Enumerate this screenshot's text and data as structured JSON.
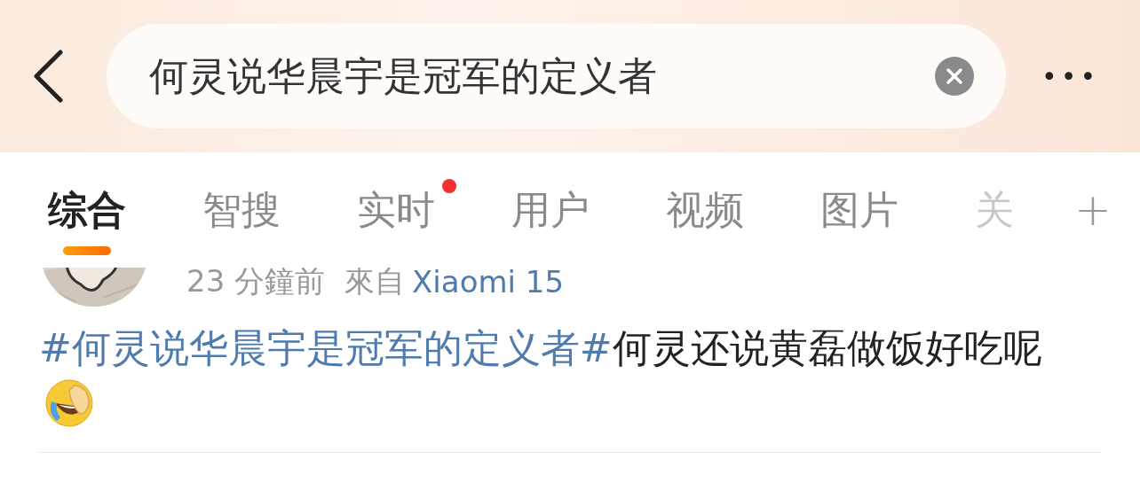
{
  "search": {
    "value": "何灵说华晨宇是冠军的定义者"
  },
  "more_button": {
    "label": "•••"
  },
  "tabs": [
    {
      "label": "综合",
      "selected": true,
      "badge": false,
      "faded": false
    },
    {
      "label": "智搜",
      "selected": false,
      "badge": false,
      "faded": false
    },
    {
      "label": "实时",
      "selected": false,
      "badge": true,
      "faded": false
    },
    {
      "label": "用户",
      "selected": false,
      "badge": false,
      "faded": false
    },
    {
      "label": "视频",
      "selected": false,
      "badge": false,
      "faded": false
    },
    {
      "label": "图片",
      "selected": false,
      "badge": false,
      "faded": false
    },
    {
      "label": "关",
      "selected": false,
      "badge": false,
      "faded": true
    }
  ],
  "add_tab": {
    "label": "+"
  },
  "post": {
    "time": "23 分鐘前",
    "source_prefix": "來自",
    "source": "Xiaomi 15",
    "text": [
      {
        "kind": "hashtag",
        "text": "#何灵说华晨宇是冠军的定义者#"
      },
      {
        "kind": "plain",
        "text": "何灵还说黄磊做饭好吃呢"
      }
    ]
  }
}
